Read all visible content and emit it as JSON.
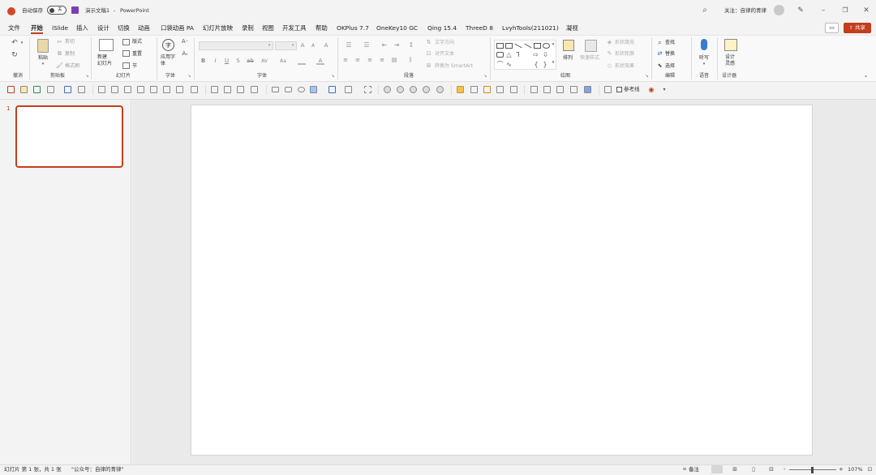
{
  "titlebar": {
    "autosave_label": "自动保存",
    "autosave_state": "关",
    "doc_title": "演示文稿1",
    "app_name": "PowerPoint",
    "title_separator": "-",
    "follow_text": "关注：自律的青律"
  },
  "tabs": [
    "文件",
    "开始",
    "iSlide",
    "插入",
    "设计",
    "切换",
    "动画",
    "口袋动画 PA",
    "幻灯片放映",
    "录制",
    "视图",
    "开发工具",
    "帮助",
    "OKPlus 7.7",
    "OneKey10 GC",
    "Qing 15.4",
    "ThreeD 8",
    "LvyhTools(211021)",
    "凝视"
  ],
  "active_tab": "开始",
  "share_label": "共享",
  "ribbon": {
    "groups": {
      "undo": "撤消",
      "clipboard": "剪贴板",
      "slides": "幻灯片",
      "font_custom": "字体",
      "font": "字体",
      "paragraph": "段落",
      "drawing": "绘图",
      "editing": "编辑",
      "voice": "语音",
      "designer": "设计器"
    },
    "clipboard": {
      "paste": "粘贴",
      "cut": "剪切",
      "copy": "复制",
      "format_painter": "格式刷"
    },
    "slides": {
      "new_slide": "新建\n幻灯片",
      "layout": "版式",
      "reset": "重置",
      "section": "节"
    },
    "font_custom": {
      "apply_font": "应用字\n体"
    },
    "paragraph": {
      "text_direction": "文字方向",
      "align_text": "对齐文本",
      "convert_smartart": "转换为 SmartArt"
    },
    "drawing": {
      "arrange": "排列",
      "quick_styles": "快速样式",
      "shape_fill": "形状填充",
      "shape_outline": "形状轮廓",
      "shape_effects": "形状效果"
    },
    "editing": {
      "find": "查找",
      "replace": "替换",
      "select": "选择"
    },
    "voice": {
      "dictate": "听写"
    },
    "designer": {
      "design_ideas": "设计\n灵感"
    }
  },
  "qat": {
    "guides_label": "参考线"
  },
  "thumbnails": [
    {
      "number": "1"
    }
  ],
  "status": {
    "slide_info": "幻灯片 第 1 张，共 1 张",
    "extra": "\"公众号：自律的青律\"",
    "notes": "备注",
    "zoom": "107%",
    "zoom_minus": "-",
    "zoom_plus": "+"
  },
  "colors": {
    "accent": "#c43e1c",
    "autosave_icon": "#d24726",
    "save_icon": "#7a3fb5"
  }
}
